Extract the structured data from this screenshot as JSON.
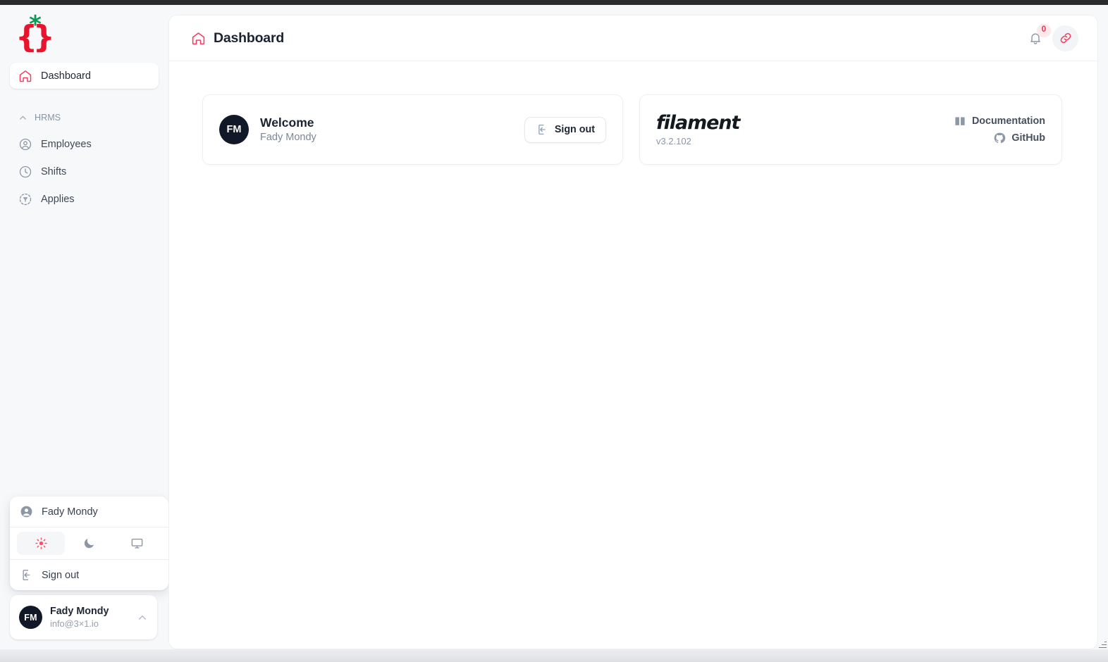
{
  "app": {
    "logo_left_brace": "{",
    "logo_star": "*",
    "logo_right_brace": "}",
    "accent_color": "#f43f5e",
    "logo_brace_color": "#e8132c",
    "logo_star_color": "#0a9a55",
    "sidebar_bg": "#f7f8fa",
    "panel_bg": "#ffffff"
  },
  "sidebar": {
    "primary": [
      {
        "label": "Dashboard",
        "icon": "home-icon",
        "active": true
      }
    ],
    "group": {
      "label": "HRMS",
      "icon": "chevron-up-icon",
      "items": [
        {
          "label": "Employees",
          "icon": "user-circle-icon"
        },
        {
          "label": "Shifts",
          "icon": "clock-icon"
        },
        {
          "label": "Applies",
          "icon": "target-icon"
        }
      ]
    },
    "user_popup": {
      "name": "Fady Mondy",
      "name_icon": "user-circle-icon",
      "themes": [
        {
          "name": "light",
          "icon": "sun-icon",
          "active": true
        },
        {
          "name": "dark",
          "icon": "moon-icon",
          "active": false
        },
        {
          "name": "system",
          "icon": "monitor-icon",
          "active": false
        }
      ],
      "sign_out_label": "Sign out",
      "sign_out_icon": "sign-out-icon"
    },
    "profile": {
      "initials": "FM",
      "name": "Fady Mondy",
      "email": "info@3×1.io",
      "toggle_icon": "chevron-up-icon"
    }
  },
  "topbar": {
    "title": "Dashboard",
    "title_icon": "home-icon",
    "notifications": {
      "icon": "bell-icon",
      "badge": "0",
      "badge_bg": "#fde8ec",
      "badge_color": "#e8314f"
    },
    "link_action": {
      "icon": "link-icon",
      "color": "#f43f5e"
    }
  },
  "main": {
    "welcome_card": {
      "initials": "FM",
      "title": "Welcome",
      "subtitle": "Fady Mondy",
      "sign_out_label": "Sign out",
      "sign_out_icon": "sign-out-icon"
    },
    "filament_card": {
      "logo_text": "filament",
      "version": "v3.2.102",
      "links": [
        {
          "label": "Documentation",
          "icon": "book-open-icon"
        },
        {
          "label": "GitHub",
          "icon": "github-icon"
        }
      ]
    }
  }
}
